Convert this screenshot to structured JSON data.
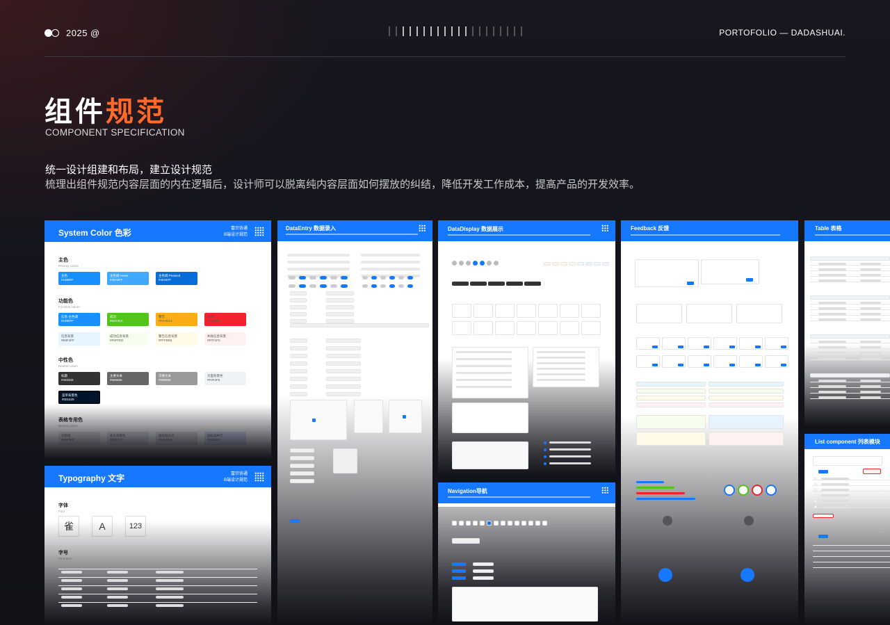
{
  "header": {
    "year": "2025 @",
    "brand": "PORTOFOLIO — DADASHUAI."
  },
  "hero": {
    "title_white": "组件",
    "title_orange": "规范",
    "subtitle": "COMPONENT SPECIFICATION",
    "headline": "统一设计组建和布局，建立设计规范",
    "description": "梳理出组件规范内容层面的内在逻辑后，设计师可以脱离纯内容层面如何摆放的纠结，降低开发工作成本，提高产品的开发效率。"
  },
  "colors": {
    "accent": "#ff6a2b",
    "primary": "#1677ff"
  },
  "cards": {
    "system_color": {
      "title": "System Color 色彩",
      "tag1": "富宗协通",
      "tag2": "B端设计规范",
      "primary": {
        "title": "主色",
        "sub": "Primary colors"
      },
      "primary_swatches": [
        {
          "label": "主色",
          "code": "#1890FF",
          "color": "#1890ff"
        },
        {
          "label": "主色调 Hover",
          "code": "#40A9FF",
          "color": "#40a9ff"
        },
        {
          "label": "主色调 Pressed",
          "code": "#4044FF",
          "color": "#096dd9"
        }
      ],
      "function": {
        "title": "功能色",
        "sub": "Function colors"
      },
      "function_swatches": [
        {
          "label": "信息-主色调",
          "code": "#1890FF",
          "color": "#1890ff"
        },
        {
          "label": "成功",
          "code": "#52C41A",
          "color": "#52c41a"
        },
        {
          "label": "警告",
          "code": "#FAAD14",
          "color": "#faad14"
        },
        {
          "label": "失败",
          "code": "#F5222D",
          "color": "#f5222d"
        }
      ],
      "function_bg_swatches": [
        {
          "label": "信息背景",
          "code": "#E6F4FF",
          "color": "#e6f4ff"
        },
        {
          "label": "成功信息背景",
          "code": "#F6FFED",
          "color": "#f6ffed"
        },
        {
          "label": "警告信息背景",
          "code": "#FFFBE6",
          "color": "#fffbe6"
        },
        {
          "label": "失败信息背景",
          "code": "#FFF1F0",
          "color": "#fff1f0"
        }
      ],
      "neutral": {
        "title": "中性色",
        "sub": "Neutral colors"
      },
      "neutral_swatches": [
        {
          "label": "标题",
          "code": "#333333",
          "color": "#333333"
        },
        {
          "label": "主要文本",
          "code": "#666666",
          "color": "#666666"
        },
        {
          "label": "次要文本",
          "code": "#999999",
          "color": "#999999"
        },
        {
          "label": "页面背景色",
          "code": "#F0F2F5",
          "color": "#f0f2f5"
        }
      ],
      "dark_swatch": {
        "label": "菜单背景色",
        "code": "#001529",
        "color": "#001529"
      },
      "table": {
        "title": "表格专用色",
        "sub": "Neutral colors"
      },
      "table_swatches": [
        {
          "label": "分割线",
          "code": "#F0F0F0",
          "color": "#e8e8e8"
        },
        {
          "label": "表头背景色",
          "code": "#EEF1F7",
          "color": "#e4e7ee"
        },
        {
          "label": "鼠标经过行",
          "code": "#E6E8E8",
          "color": "#dfe2e6"
        },
        {
          "label": "鼠标选中行",
          "code": "#DCE9FF",
          "color": "#d6e3f7"
        }
      ]
    },
    "typography": {
      "title": "Typography 文字",
      "tag1": "富宗协通",
      "tag2": "B端设计规范",
      "font_title": "字体",
      "font_sub": "Font",
      "glyph1": "雀",
      "glyph2": "A",
      "glyph3": "123",
      "size_title": "字号",
      "size_sub": "Font Size"
    },
    "dataentry": {
      "title": "DataEntry 数据录入"
    },
    "datadisplay": {
      "title": "DataDisplay 数据展示"
    },
    "navigation": {
      "title": "Navigation导航"
    },
    "feedback": {
      "title": "Feedback 反馈"
    },
    "table": {
      "title": "Table 表格"
    },
    "list": {
      "title": "List component 列表模块"
    }
  }
}
